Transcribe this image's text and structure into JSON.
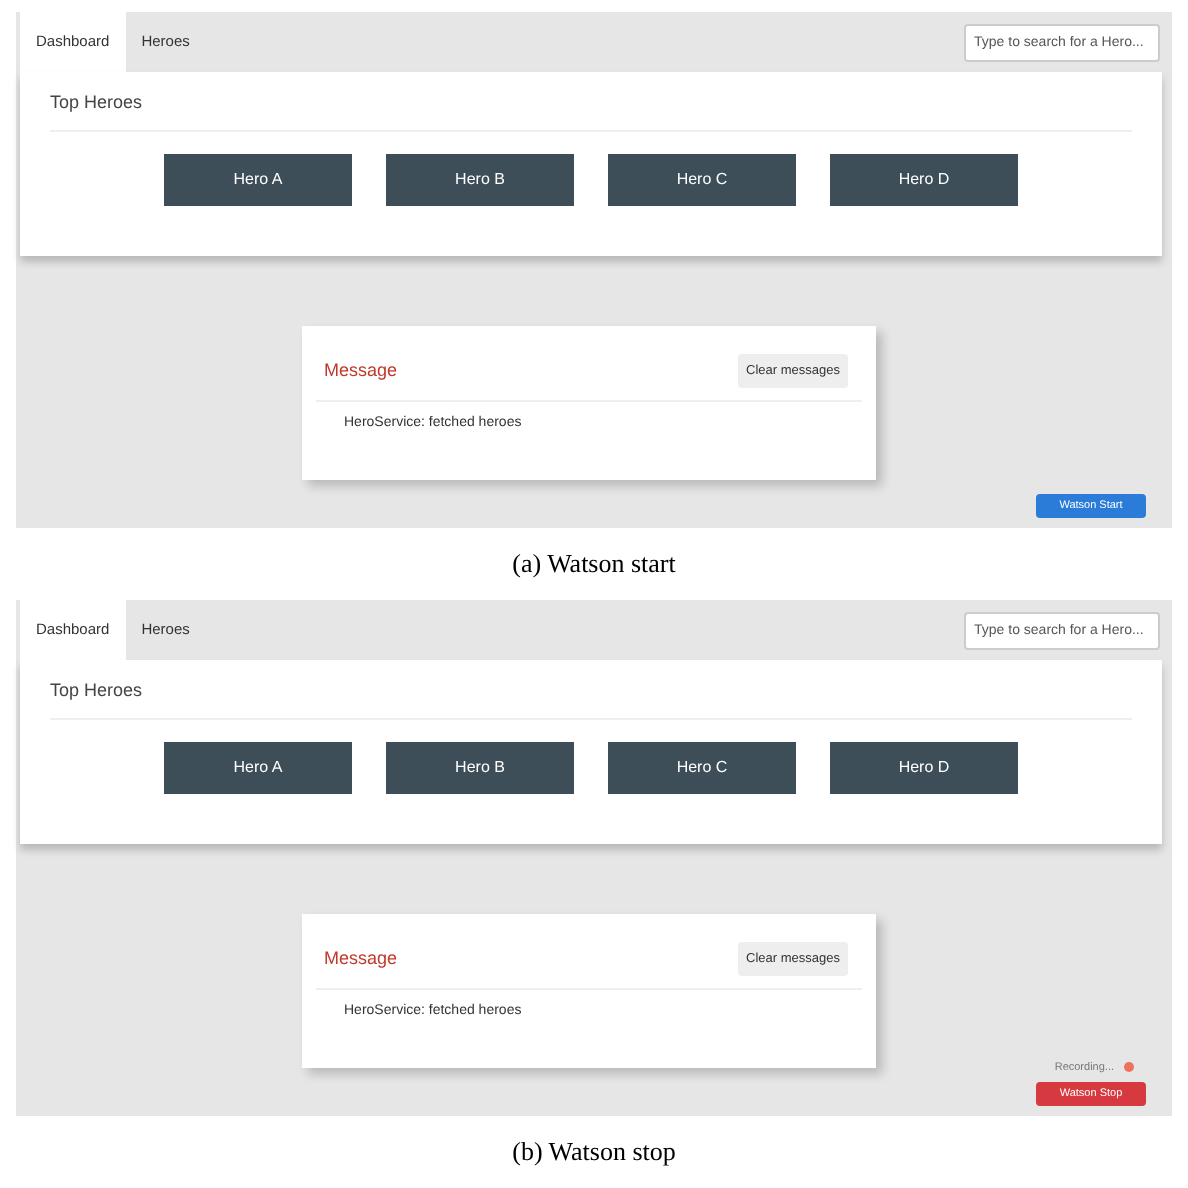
{
  "panels": [
    {
      "tabs": [
        {
          "label": "Dashboard",
          "selected": true
        },
        {
          "label": "Heroes",
          "selected": false
        }
      ],
      "search": {
        "placeholder": "Type to search for a Hero..."
      },
      "top_heroes": {
        "title": "Top Heroes",
        "heroes": [
          "Hero A",
          "Hero B",
          "Hero C",
          "Hero D"
        ]
      },
      "messages": {
        "title": "Message",
        "clear_button": "Clear messages",
        "items": [
          "HeroService: fetched heroes"
        ]
      },
      "watson": {
        "kind": "start",
        "label": "Watson Start"
      },
      "caption": "(a) Watson start"
    },
    {
      "tabs": [
        {
          "label": "Dashboard",
          "selected": true
        },
        {
          "label": "Heroes",
          "selected": false
        }
      ],
      "search": {
        "placeholder": "Type to search for a Hero..."
      },
      "top_heroes": {
        "title": "Top Heroes",
        "heroes": [
          "Hero A",
          "Hero B",
          "Hero C",
          "Hero D"
        ]
      },
      "messages": {
        "title": "Message",
        "clear_button": "Clear messages",
        "items": [
          "HeroService: fetched heroes"
        ]
      },
      "watson": {
        "kind": "stop",
        "label": "Watson Stop",
        "recording": "Recording..."
      },
      "caption": "(b) Watson stop"
    }
  ]
}
